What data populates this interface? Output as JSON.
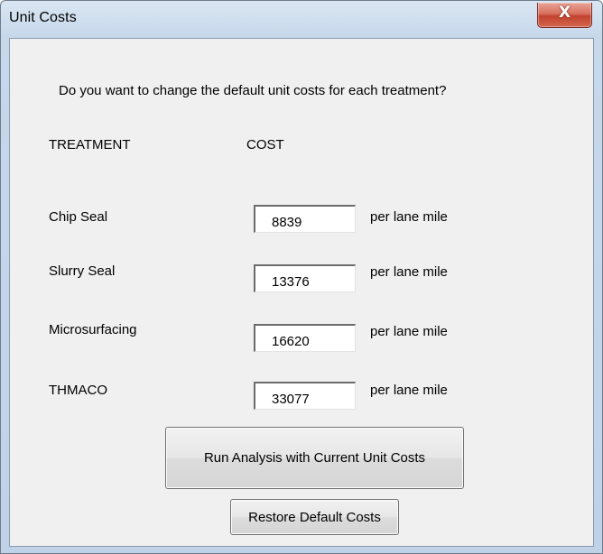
{
  "window": {
    "title": "Unit Costs",
    "close_glyph": "X"
  },
  "dialog": {
    "prompt": "Do you want to change the default unit costs for each treatment?",
    "headers": {
      "treatment": "TREATMENT",
      "cost": "COST"
    },
    "rows": [
      {
        "treatment": "Chip Seal",
        "cost": "8839",
        "unit": "per lane mile"
      },
      {
        "treatment": "Slurry Seal",
        "cost": "13376",
        "unit": "per lane mile"
      },
      {
        "treatment": "Microsurfacing",
        "cost": "16620",
        "unit": "per lane mile"
      },
      {
        "treatment": "THMACO",
        "cost": "33077",
        "unit": "per lane mile"
      }
    ],
    "buttons": {
      "run": "Run Analysis with Current Unit Costs",
      "restore": "Restore Default Costs"
    }
  },
  "icons": {
    "close": "close-icon"
  }
}
